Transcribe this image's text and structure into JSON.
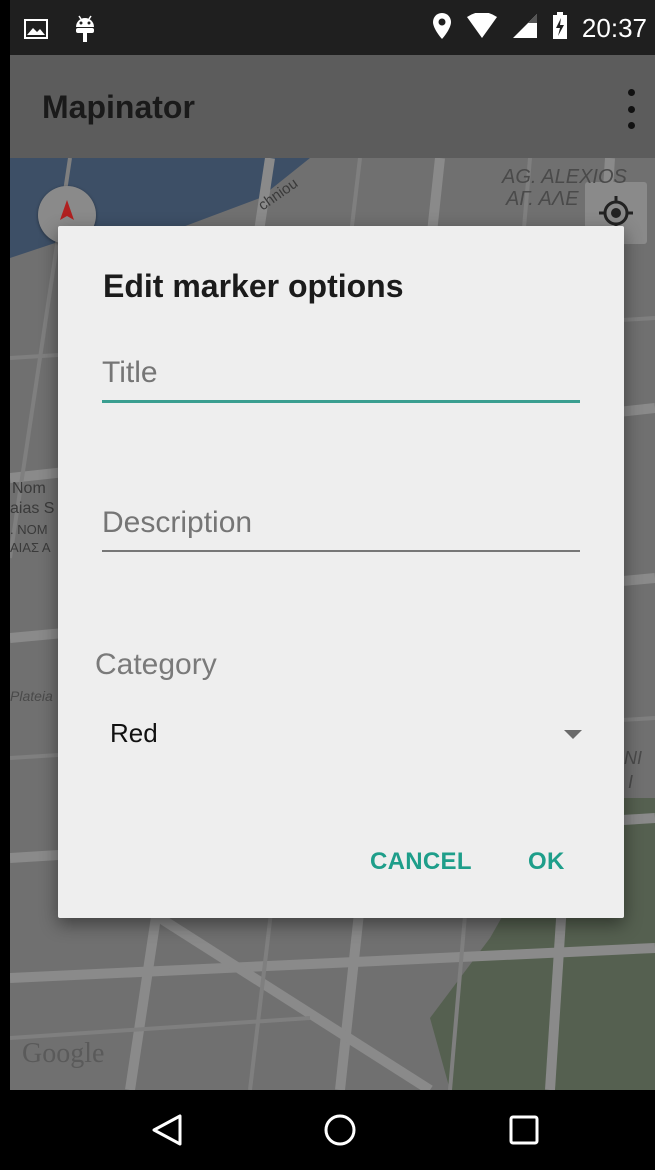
{
  "status_bar": {
    "time": "20:37",
    "icons": [
      "image-icon",
      "android-icon",
      "location-pin-icon",
      "wifi-icon",
      "cell-signal-icon",
      "battery-charging-icon"
    ]
  },
  "app_bar": {
    "title": "Mapinator",
    "overflow_icon": "more-vert-icon"
  },
  "map": {
    "labels": [
      "AG. ALEXIOS",
      "ΑΓ. ΑΛΕ",
      "chniou",
      "Nom",
      "aias S",
      ". NOM",
      "ΑΙΑΣ Α",
      "Plateia",
      "NI",
      "I"
    ],
    "logo": "Google"
  },
  "dialog": {
    "title": "Edit marker options",
    "title_field": {
      "value": "",
      "placeholder": "Title"
    },
    "description_field": {
      "value": "",
      "placeholder": "Description"
    },
    "category_label": "Category",
    "category_selected": "Red",
    "cancel_label": "CANCEL",
    "ok_label": "OK"
  },
  "colors": {
    "accent": "#1e9e8a",
    "dialog_bg": "#eeeeee",
    "app_bar": "#5c5c5c",
    "status_bar": "#1f1f1f"
  },
  "nav_bar": {
    "icons": [
      "back-icon",
      "home-icon",
      "recents-icon"
    ]
  }
}
